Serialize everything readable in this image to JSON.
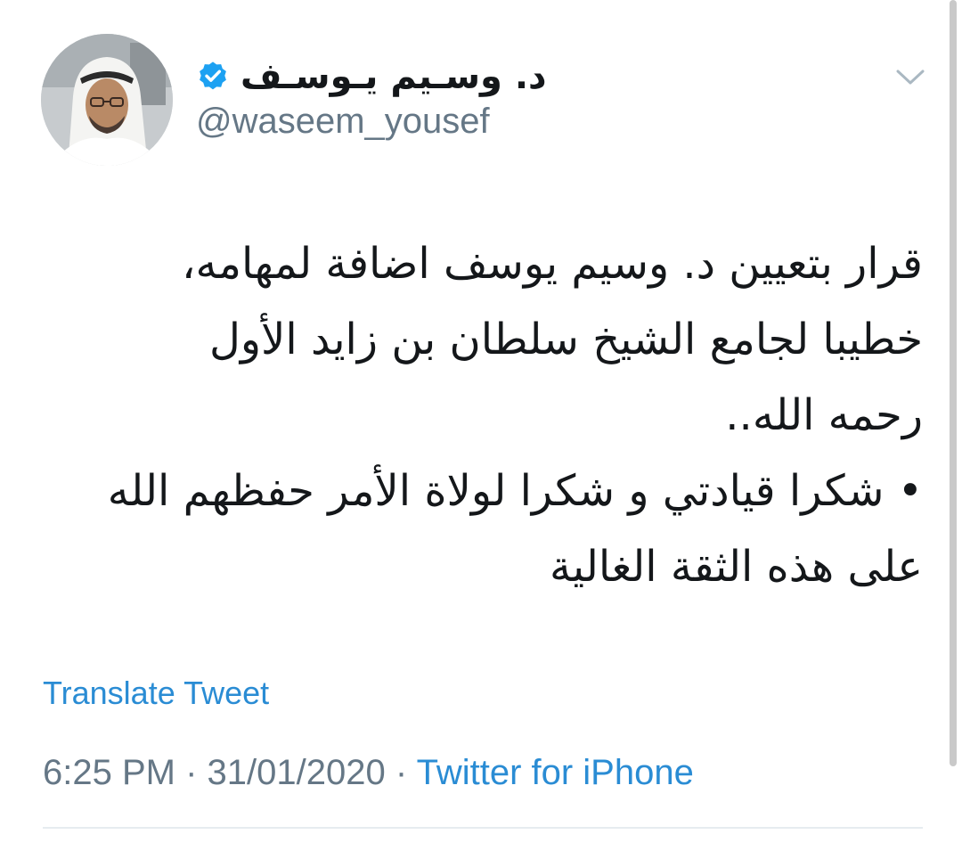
{
  "tweet": {
    "display_name": "د. وسـيم يـوسـف",
    "handle": "@waseem_yousef",
    "verified_icon": "verified-badge-icon",
    "avatar_icon": "profile-avatar",
    "menu_icon": "chevron-down-icon",
    "body_lines": [
      "قرار بتعيين د. وسيم يوسف اضافة لمهامه،",
      "خطيبا لجامع الشيخ سلطان بن زايد الأول",
      "رحمه الله..",
      "• شكرا قيادتي و شكرا لولاة الأمر حفظهم الله",
      "على هذه الثقة الغالية"
    ],
    "translate_label": "Translate Tweet",
    "time": "6:25 PM",
    "separator": "·",
    "date": "31/01/2020",
    "source": "Twitter for iPhone"
  },
  "colors": {
    "accent": "#1da1f2",
    "link": "#2a8cd4",
    "muted": "#657786",
    "text": "#14171a"
  }
}
